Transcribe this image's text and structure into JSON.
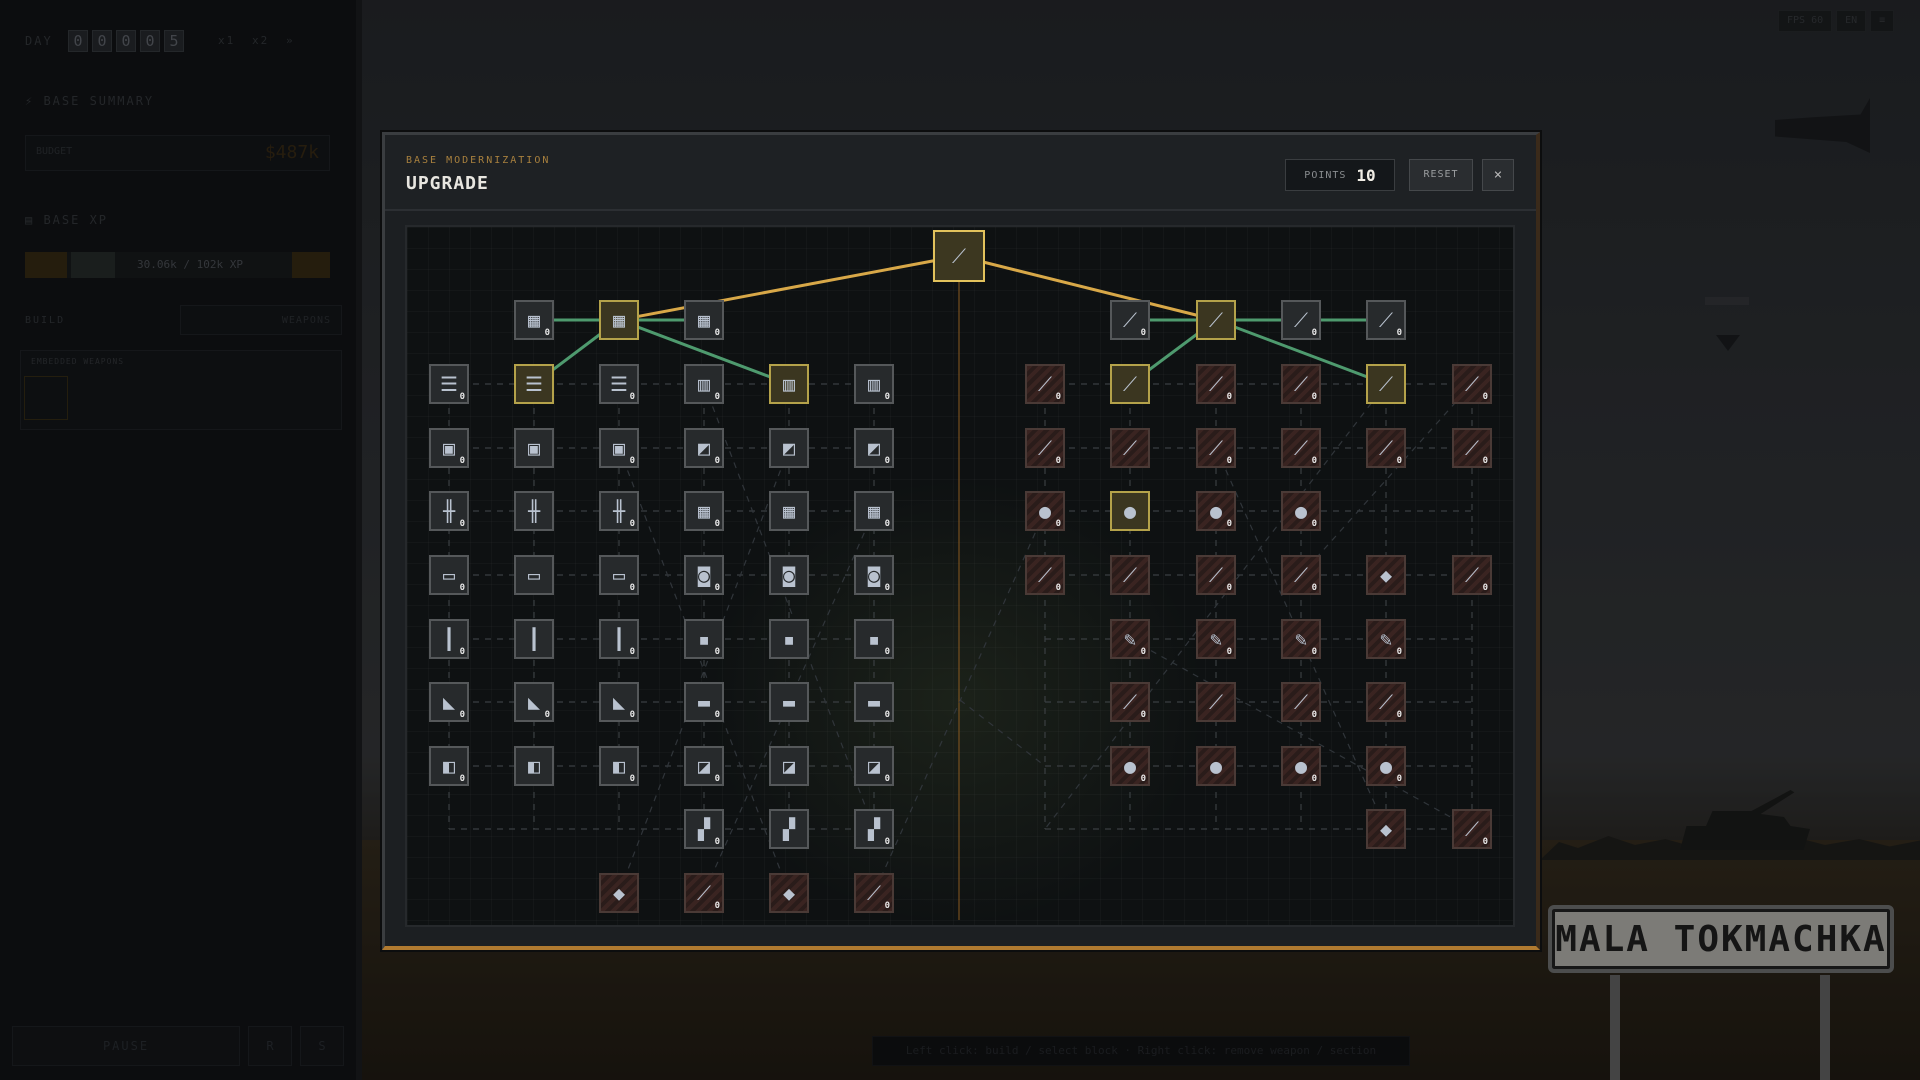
{
  "sidebar": {
    "day_label": "DAY",
    "day_digits": [
      "0",
      "0",
      "0",
      "0",
      "5"
    ],
    "speed": [
      "x1",
      "x2",
      "»"
    ],
    "base_summary": "BASE SUMMARY",
    "budget_label": "BUDGET",
    "budget_value": "$487k",
    "base_xp": "BASE XP",
    "xp_text": "30.06k / 102k XP",
    "tabs": [
      "BUILD",
      "WEAPONS"
    ],
    "embedded": "EMBEDDED WEAPONS",
    "pause": "PAUSE",
    "small_btns": [
      "R",
      "S"
    ]
  },
  "hint": "Left click: build / select block · Right click: remove weapon / section",
  "top_right": [
    "FPS 60",
    "EN",
    "≡"
  ],
  "sign_text": "MALA TOKMACHKA",
  "modal": {
    "subtitle": "BASE MODERNIZATION",
    "title": "UPGRADE",
    "points_label": "POINTS",
    "points_value": "10",
    "reset_label": "RESET",
    "close_glyph": "×"
  },
  "colors": {
    "accent": "#e2c25c",
    "link_active": "#d8a848",
    "link_green": "#4e9a6e"
  },
  "tree": {
    "root": {
      "icon": "weapon-icon",
      "glyph": "⟋"
    },
    "nodes": [
      {
        "id": "l1a",
        "state": "avail",
        "icon": "panel-icon",
        "glyph": "▦",
        "count": "0"
      },
      {
        "id": "l1b",
        "state": "owned",
        "icon": "panel-icon",
        "glyph": "▦",
        "count": ""
      },
      {
        "id": "l1c",
        "state": "avail",
        "icon": "panel-icon",
        "glyph": "▦",
        "count": "0"
      },
      {
        "id": "r1a",
        "state": "avail",
        "icon": "rifle-icon",
        "glyph": "⟋",
        "count": "0"
      },
      {
        "id": "r1b",
        "state": "owned",
        "icon": "rifle-icon",
        "glyph": "⟋",
        "count": ""
      },
      {
        "id": "r1c",
        "state": "avail",
        "icon": "rifle-icon",
        "glyph": "⟋",
        "count": "0"
      },
      {
        "id": "r1d",
        "state": "avail",
        "icon": "rifle-icon",
        "glyph": "⟋",
        "count": "0"
      }
    ],
    "grid_left": [
      [
        {
          "s": "avail",
          "g": "☰",
          "c": "g-panel",
          "n": "0"
        },
        {
          "s": "owned",
          "g": "☰",
          "c": "g-panel",
          "n": ""
        },
        {
          "s": "avail",
          "g": "☰",
          "c": "g-panel",
          "n": "0"
        },
        {
          "s": "avail",
          "g": "▥",
          "c": "g-panel",
          "n": "0"
        },
        {
          "s": "owned",
          "g": "▥",
          "c": "g-panel",
          "n": ""
        },
        {
          "s": "avail",
          "g": "▥",
          "c": "g-panel",
          "n": "0"
        }
      ],
      [
        {
          "s": "avail",
          "g": "▣",
          "c": "g-box",
          "n": "0"
        },
        {
          "s": "avail",
          "g": "▣",
          "c": "g-box",
          "n": ""
        },
        {
          "s": "avail",
          "g": "▣",
          "c": "g-box",
          "n": "0"
        },
        {
          "s": "avail",
          "g": "◩",
          "c": "g-white",
          "n": "0"
        },
        {
          "s": "avail",
          "g": "◩",
          "c": "g-white",
          "n": ""
        },
        {
          "s": "avail",
          "g": "◩",
          "c": "g-white",
          "n": "0"
        }
      ],
      [
        {
          "s": "avail",
          "g": "╫",
          "c": "g-panel",
          "n": "0"
        },
        {
          "s": "avail",
          "g": "╫",
          "c": "g-panel",
          "n": ""
        },
        {
          "s": "avail",
          "g": "╫",
          "c": "g-panel",
          "n": "0"
        },
        {
          "s": "avail",
          "g": "▦",
          "c": "g-grid",
          "n": "0"
        },
        {
          "s": "avail",
          "g": "▦",
          "c": "g-grid",
          "n": ""
        },
        {
          "s": "avail",
          "g": "▦",
          "c": "g-grid",
          "n": "0"
        }
      ],
      [
        {
          "s": "avail",
          "g": "▭",
          "c": "g-blue",
          "n": "0"
        },
        {
          "s": "avail",
          "g": "▭",
          "c": "g-blue",
          "n": ""
        },
        {
          "s": "avail",
          "g": "▭",
          "c": "g-blue",
          "n": "0"
        },
        {
          "s": "avail",
          "g": "◙",
          "c": "g-gray",
          "n": "0"
        },
        {
          "s": "avail",
          "g": "◙",
          "c": "g-gray",
          "n": ""
        },
        {
          "s": "avail",
          "g": "◙",
          "c": "g-gray",
          "n": "0"
        }
      ],
      [
        {
          "s": "avail",
          "g": "┃",
          "c": "g-blue",
          "n": "0"
        },
        {
          "s": "avail",
          "g": "┃",
          "c": "g-blue",
          "n": ""
        },
        {
          "s": "avail",
          "g": "┃",
          "c": "g-blue",
          "n": "0"
        },
        {
          "s": "avail",
          "g": "▪",
          "c": "g-dark",
          "n": "0"
        },
        {
          "s": "avail",
          "g": "▪",
          "c": "g-dark",
          "n": ""
        },
        {
          "s": "avail",
          "g": "▪",
          "c": "g-dark",
          "n": "0"
        }
      ],
      [
        {
          "s": "avail",
          "g": "◣",
          "c": "g-gray",
          "n": "0"
        },
        {
          "s": "avail",
          "g": "◣",
          "c": "g-gray",
          "n": "0"
        },
        {
          "s": "avail",
          "g": "◣",
          "c": "g-gray",
          "n": "0"
        },
        {
          "s": "avail",
          "g": "▬",
          "c": "g-blue",
          "n": "0"
        },
        {
          "s": "avail",
          "g": "▬",
          "c": "g-blue",
          "n": ""
        },
        {
          "s": "avail",
          "g": "▬",
          "c": "g-blue",
          "n": "0"
        }
      ],
      [
        {
          "s": "avail",
          "g": "◧",
          "c": "g-box",
          "n": "0"
        },
        {
          "s": "avail",
          "g": "◧",
          "c": "g-box",
          "n": ""
        },
        {
          "s": "avail",
          "g": "◧",
          "c": "g-box",
          "n": "0"
        },
        {
          "s": "avail",
          "g": "◪",
          "c": "g-panel",
          "n": "0"
        },
        {
          "s": "avail",
          "g": "◪",
          "c": "g-panel",
          "n": ""
        },
        {
          "s": "avail",
          "g": "◪",
          "c": "g-panel",
          "n": "0"
        }
      ]
    ],
    "row8_left": [
      {
        "s": "avail",
        "g": "▞",
        "c": "g-white",
        "n": "0"
      },
      {
        "s": "avail",
        "g": "▞",
        "c": "g-white",
        "n": ""
      },
      {
        "s": "avail",
        "g": "▞",
        "c": "g-white",
        "n": "0"
      }
    ],
    "row9_left": [
      {
        "s": "locked",
        "g": "◆",
        "c": "g-dark",
        "n": ""
      },
      {
        "s": "locked",
        "g": "⟋",
        "c": "g-dark",
        "n": "0"
      },
      {
        "s": "locked",
        "g": "◆",
        "c": "g-dark",
        "n": ""
      },
      {
        "s": "locked",
        "g": "⟋",
        "c": "g-dark",
        "n": "0"
      }
    ],
    "grid_right": [
      [
        {
          "s": "locked",
          "g": "⟋",
          "c": "g-blue",
          "n": "0"
        },
        {
          "s": "owned",
          "g": "⟋",
          "c": "g-gray",
          "n": ""
        },
        {
          "s": "locked",
          "g": "⟋",
          "c": "g-blue",
          "n": "0"
        },
        {
          "s": "locked",
          "g": "⟋",
          "c": "g-blue",
          "n": "0"
        },
        {
          "s": "owned",
          "g": "⟋",
          "c": "g-white",
          "n": ""
        },
        {
          "s": "locked",
          "g": "⟋",
          "c": "g-white",
          "n": "0"
        }
      ],
      [
        {
          "s": "locked",
          "g": "⟋",
          "c": "g-blue",
          "n": "0"
        },
        {
          "s": "locked",
          "g": "⟋",
          "c": "g-blue",
          "n": ""
        },
        {
          "s": "locked",
          "g": "⟋",
          "c": "g-blue",
          "n": "0"
        },
        {
          "s": "locked",
          "g": "⟋",
          "c": "g-blue",
          "n": "0"
        },
        {
          "s": "locked",
          "g": "⟋",
          "c": "g-white",
          "n": "0"
        },
        {
          "s": "locked",
          "g": "⟋",
          "c": "g-white",
          "n": "0"
        }
      ],
      [
        {
          "s": "locked",
          "g": "●",
          "c": "g-orange",
          "n": "0"
        },
        {
          "s": "owned",
          "g": "●",
          "c": "g-orange",
          "n": ""
        },
        {
          "s": "locked",
          "g": "●",
          "c": "g-orange",
          "n": "0"
        },
        {
          "s": "locked",
          "g": "●",
          "c": "g-orange",
          "n": "0"
        }
      ],
      [
        {
          "s": "locked",
          "g": "⟋",
          "c": "g-blue",
          "n": "0"
        },
        {
          "s": "locked",
          "g": "⟋",
          "c": "g-blue",
          "n": ""
        },
        {
          "s": "locked",
          "g": "⟋",
          "c": "g-blue",
          "n": "0"
        },
        {
          "s": "locked",
          "g": "⟋",
          "c": "g-blue",
          "n": "0"
        },
        {
          "s": "locked",
          "g": "◆",
          "c": "g-dark",
          "n": ""
        },
        {
          "s": "locked",
          "g": "⟋",
          "c": "g-dark",
          "n": "0"
        }
      ],
      [
        {
          "s": "locked",
          "g": "✎",
          "c": "g-white",
          "n": "0"
        },
        {
          "s": "locked",
          "g": "✎",
          "c": "g-white",
          "n": "0"
        },
        {
          "s": "locked",
          "g": "✎",
          "c": "g-white",
          "n": "0"
        },
        {
          "s": "locked",
          "g": "✎",
          "c": "g-white",
          "n": "0"
        }
      ],
      [
        {
          "s": "locked",
          "g": "⟋",
          "c": "g-gray",
          "n": "0"
        },
        {
          "s": "locked",
          "g": "⟋",
          "c": "g-gray",
          "n": ""
        },
        {
          "s": "locked",
          "g": "⟋",
          "c": "g-gray",
          "n": "0"
        },
        {
          "s": "locked",
          "g": "⟋",
          "c": "g-blue",
          "n": "0"
        }
      ],
      [
        {
          "s": "locked",
          "g": "●",
          "c": "g-blue",
          "n": "0"
        },
        {
          "s": "locked",
          "g": "●",
          "c": "g-blue",
          "n": ""
        },
        {
          "s": "locked",
          "g": "●",
          "c": "g-blue",
          "n": "0"
        },
        {
          "s": "locked",
          "g": "●",
          "c": "g-blue",
          "n": "0"
        }
      ]
    ],
    "row8_right": [
      {
        "s": "locked",
        "g": "◆",
        "c": "g-dark",
        "n": ""
      },
      {
        "s": "locked",
        "g": "⟋",
        "c": "g-dark",
        "n": "0"
      }
    ]
  }
}
